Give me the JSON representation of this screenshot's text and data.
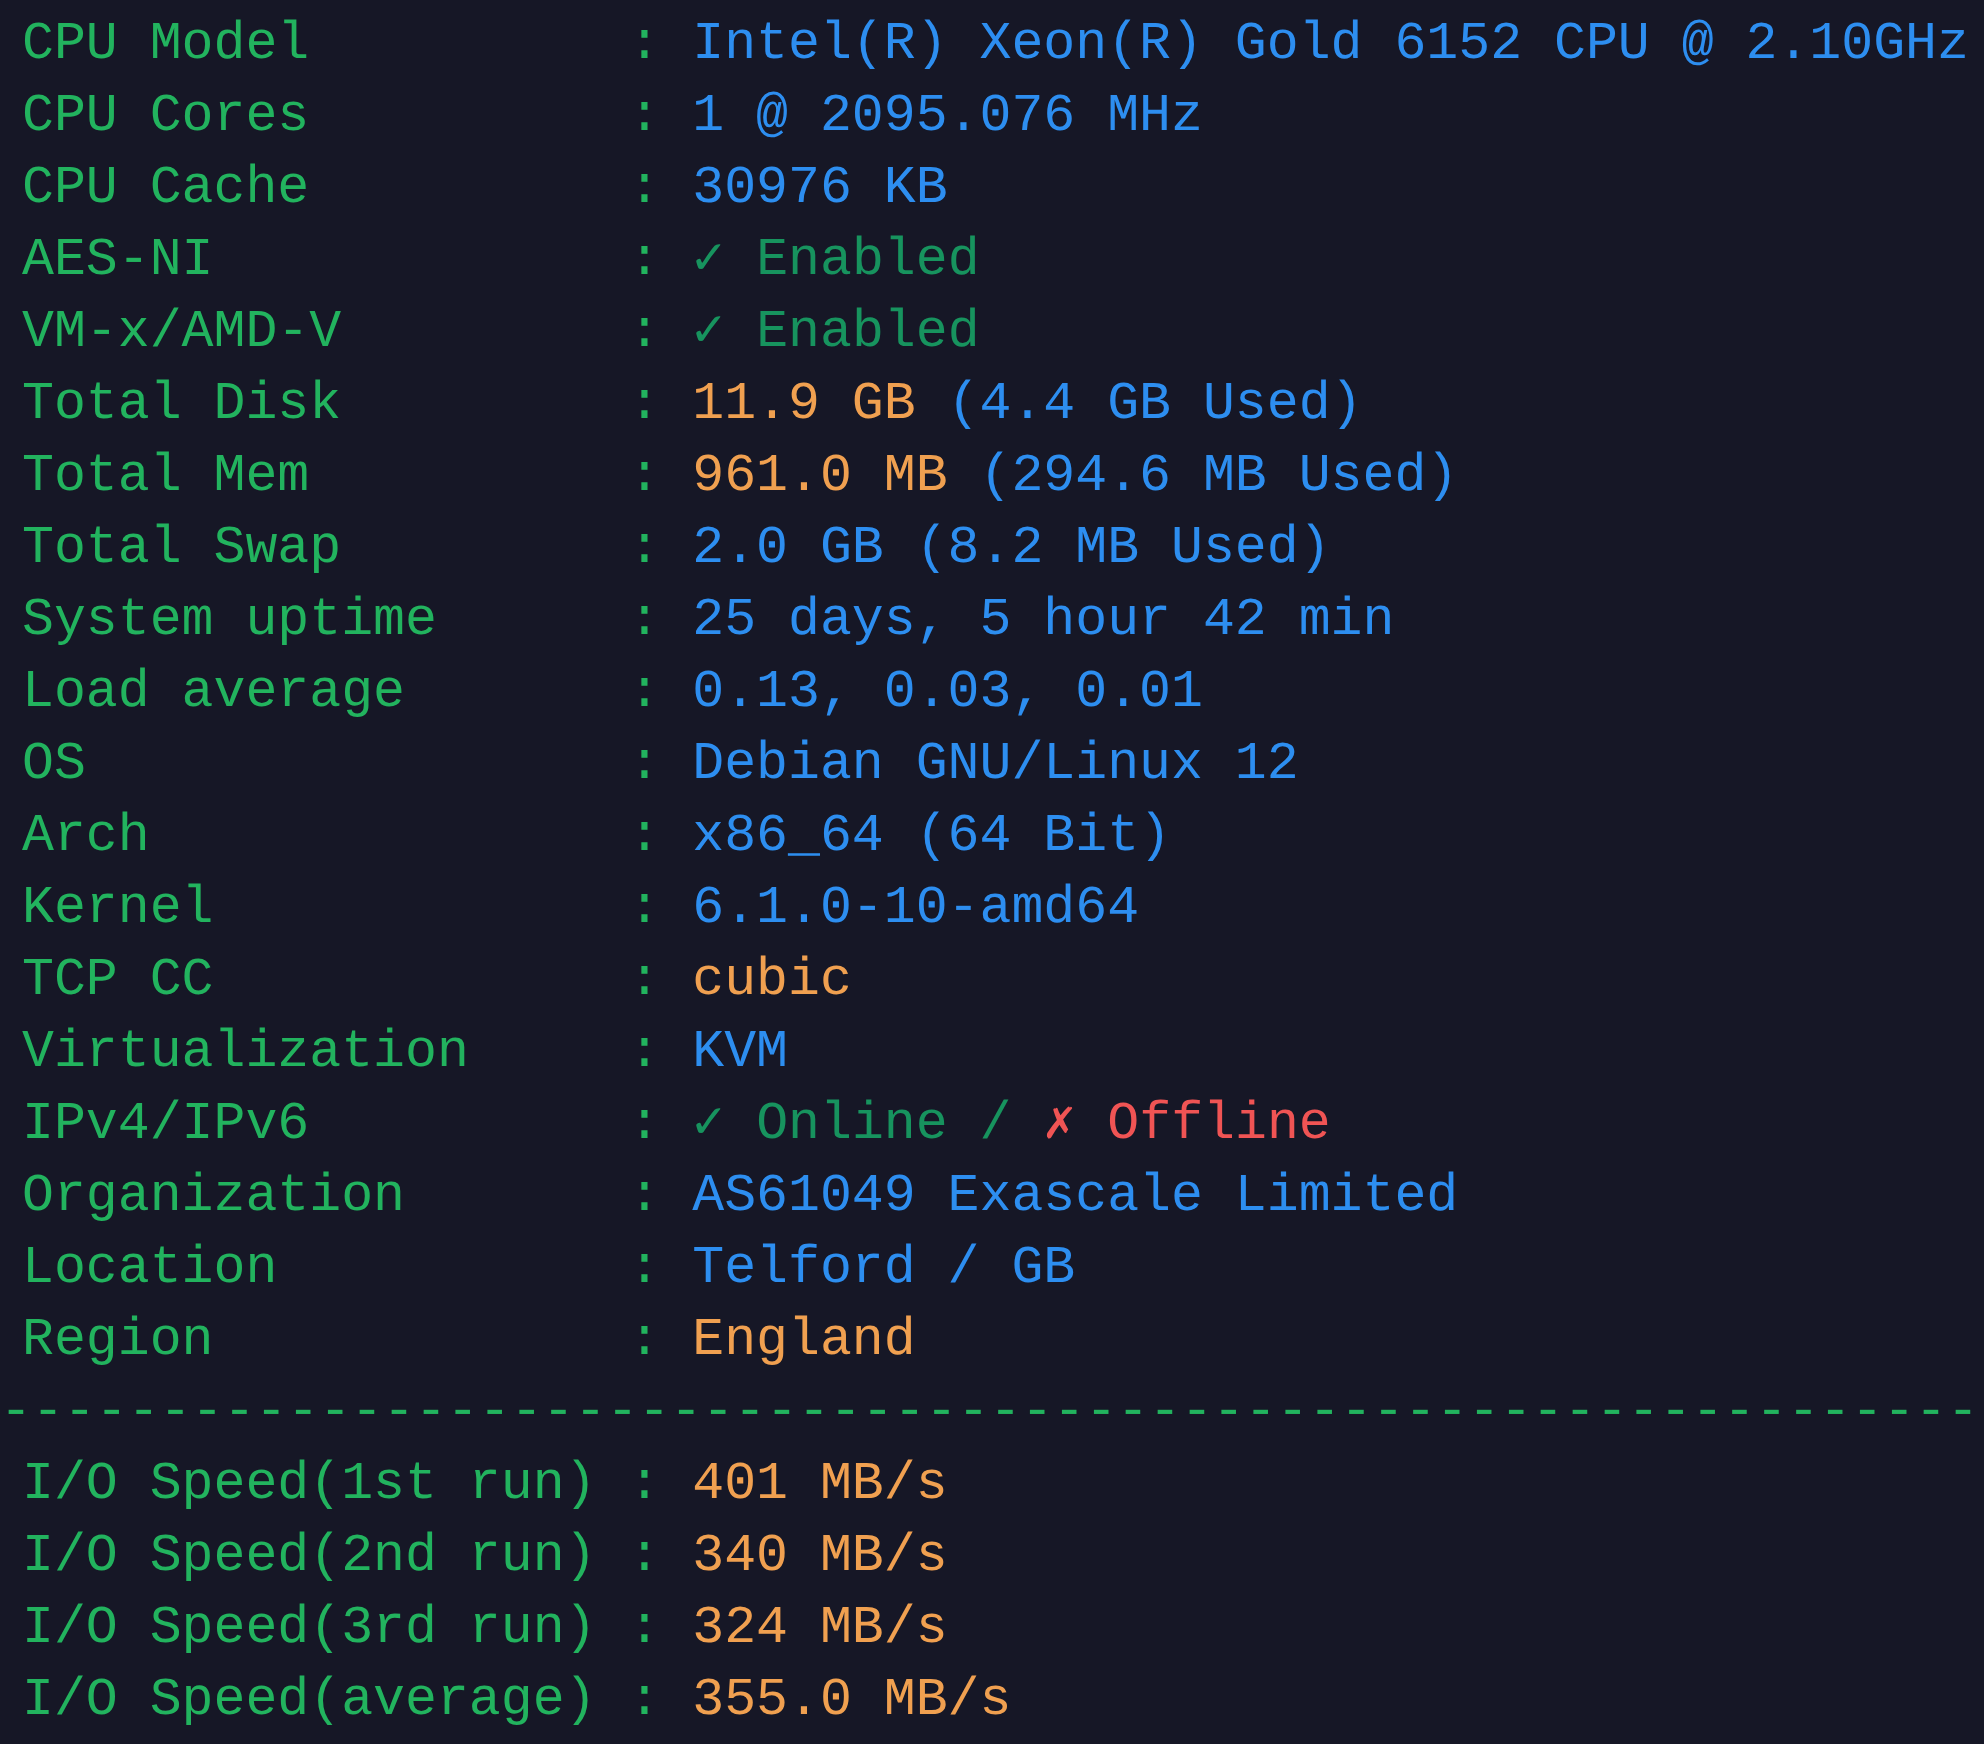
{
  "sections": [
    {
      "rows": [
        {
          "label": "CPU Model",
          "sep": ":",
          "value": [
            {
              "kind": "info",
              "text": "Intel(R) Xeon(R) Gold 6152 CPU @ 2.10GHz"
            }
          ]
        },
        {
          "label": "CPU Cores",
          "sep": ":",
          "value": [
            {
              "kind": "info",
              "text": "1 @ 2095.076 MHz"
            }
          ]
        },
        {
          "label": "CPU Cache",
          "sep": ":",
          "value": [
            {
              "kind": "info",
              "text": "30976 KB"
            }
          ]
        },
        {
          "label": "AES-NI",
          "sep": ":",
          "value": [
            {
              "kind": "ok",
              "text": "✓ Enabled"
            }
          ]
        },
        {
          "label": "VM-x/AMD-V",
          "sep": ":",
          "value": [
            {
              "kind": "ok",
              "text": "✓ Enabled"
            }
          ]
        },
        {
          "label": "Total Disk",
          "sep": ":",
          "value": [
            {
              "kind": "metric",
              "text": "11.9 GB"
            },
            {
              "kind": "info",
              "text": "(4.4 GB Used)"
            }
          ]
        },
        {
          "label": "Total Mem",
          "sep": ":",
          "value": [
            {
              "kind": "metric",
              "text": "961.0 MB"
            },
            {
              "kind": "info",
              "text": "(294.6 MB Used)"
            }
          ]
        },
        {
          "label": "Total Swap",
          "sep": ":",
          "value": [
            {
              "kind": "info",
              "text": "2.0 GB (8.2 MB Used)"
            }
          ]
        },
        {
          "label": "System uptime",
          "sep": ":",
          "value": [
            {
              "kind": "info",
              "text": "25 days, 5 hour 42 min"
            }
          ]
        },
        {
          "label": "Load average",
          "sep": ":",
          "value": [
            {
              "kind": "info",
              "text": "0.13, 0.03, 0.01"
            }
          ]
        },
        {
          "label": "OS",
          "sep": ":",
          "value": [
            {
              "kind": "info",
              "text": "Debian GNU/Linux 12"
            }
          ]
        },
        {
          "label": "Arch",
          "sep": ":",
          "value": [
            {
              "kind": "info",
              "text": "x86_64 (64 Bit)"
            }
          ]
        },
        {
          "label": "Kernel",
          "sep": ":",
          "value": [
            {
              "kind": "info",
              "text": "6.1.0-10-amd64"
            }
          ]
        },
        {
          "label": "TCP CC",
          "sep": ":",
          "value": [
            {
              "kind": "metric",
              "text": "cubic"
            }
          ]
        },
        {
          "label": "Virtualization",
          "sep": ":",
          "value": [
            {
              "kind": "info",
              "text": "KVM"
            }
          ]
        },
        {
          "label": "IPv4/IPv6",
          "sep": ":",
          "value": [
            {
              "kind": "ok",
              "text": "✓ Online /"
            },
            {
              "kind": "error",
              "text": "✗ Offline"
            }
          ]
        },
        {
          "label": "Organization",
          "sep": ":",
          "value": [
            {
              "kind": "info",
              "text": "AS61049 Exascale Limited"
            }
          ]
        },
        {
          "label": "Location",
          "sep": ":",
          "value": [
            {
              "kind": "info",
              "text": "Telford / GB"
            }
          ]
        },
        {
          "label": "Region",
          "sep": ":",
          "value": [
            {
              "kind": "metric",
              "text": "England"
            }
          ]
        }
      ]
    },
    {
      "divider": "--------------------------------------------------------------",
      "rows": [
        {
          "label": "I/O Speed(1st run)",
          "sep": ":",
          "value": [
            {
              "kind": "metric",
              "text": "401 MB/s"
            }
          ]
        },
        {
          "label": "I/O Speed(2nd run)",
          "sep": ":",
          "value": [
            {
              "kind": "metric",
              "text": "340 MB/s"
            }
          ]
        },
        {
          "label": "I/O Speed(3rd run)",
          "sep": ":",
          "value": [
            {
              "kind": "metric",
              "text": "324 MB/s"
            }
          ]
        },
        {
          "label": "I/O Speed(average)",
          "sep": ":",
          "value": [
            {
              "kind": "metric",
              "text": "355.0 MB/s"
            }
          ]
        }
      ]
    }
  ]
}
